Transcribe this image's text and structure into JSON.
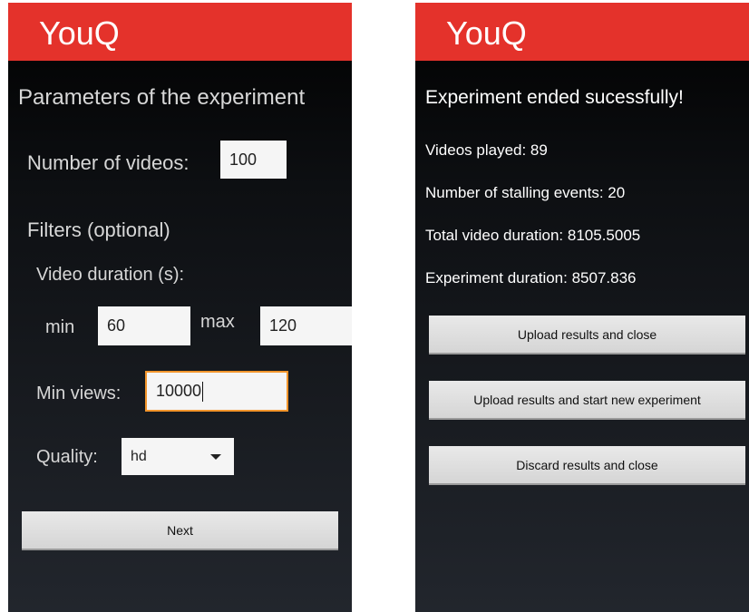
{
  "left_screen": {
    "app_title": "YouQ",
    "heading": "Parameters of the experiment",
    "num_videos_label": "Number of videos:",
    "num_videos_value": "100",
    "filters_label": "Filters (optional)",
    "duration_label": "Video duration (s):",
    "min_label": "min",
    "min_value": "60",
    "max_label": "max",
    "max_value": "120",
    "min_views_label": "Min views:",
    "min_views_value": "10000",
    "quality_label": "Quality:",
    "quality_selected": "hd",
    "next_button": "Next"
  },
  "right_screen": {
    "app_title": "YouQ",
    "heading": "Experiment ended sucessfully!",
    "videos_played": "Videos played: 89",
    "stalling_events": "Number of stalling events: 20",
    "total_duration": "Total video duration: 8105.5005",
    "experiment_duration": "Experiment duration: 8507.836",
    "buttons": {
      "upload_close": "Upload results and close",
      "upload_new": "Upload results and start new experiment",
      "discard_close": "Discard results and close"
    }
  },
  "colors": {
    "appbar": "#e4322b",
    "focus_border": "#f2952b"
  }
}
